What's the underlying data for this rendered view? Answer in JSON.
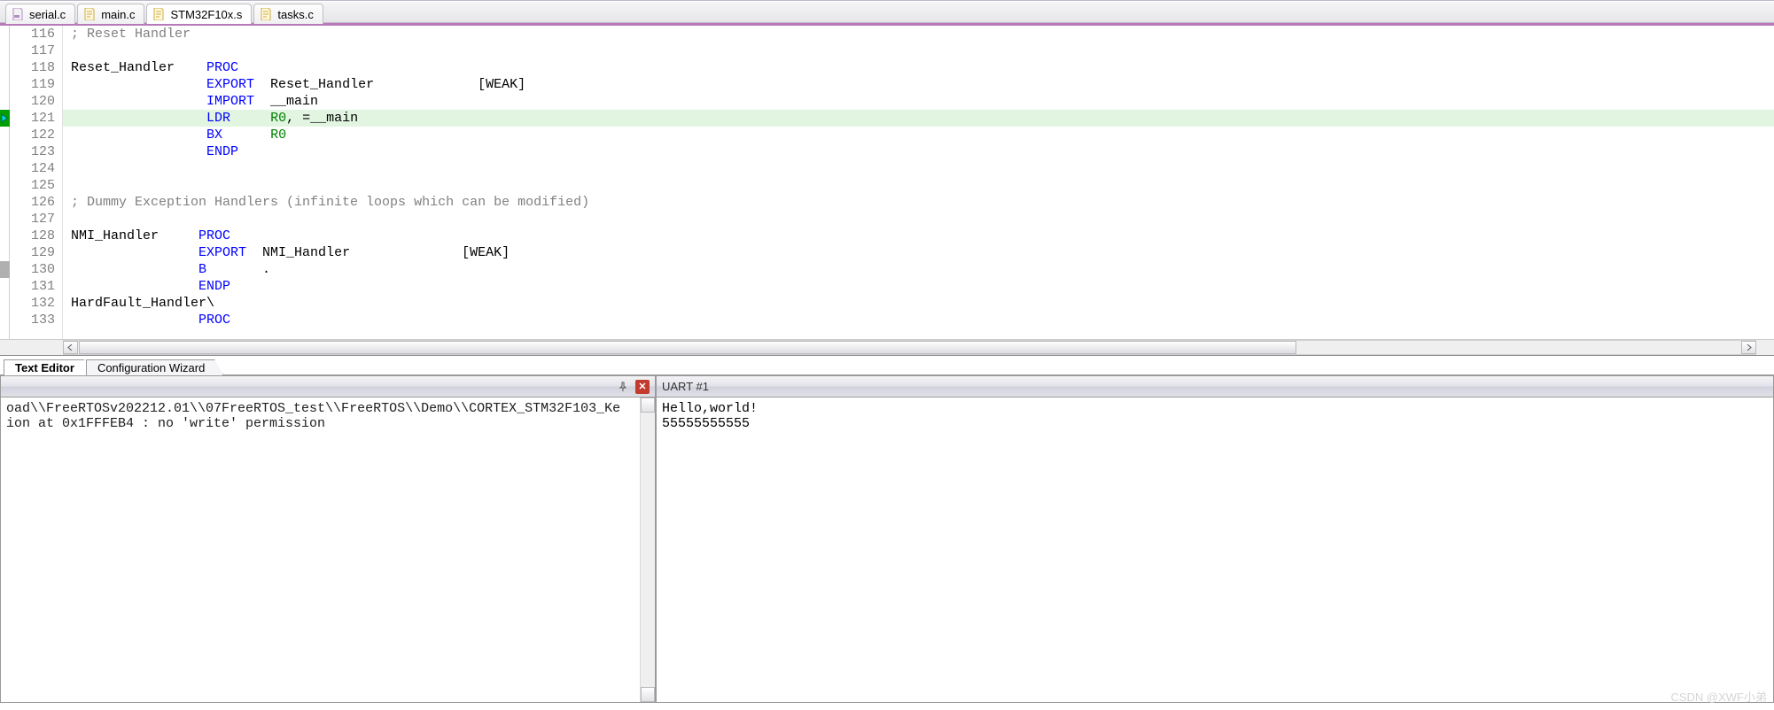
{
  "tabs": {
    "items": [
      {
        "label": "serial.c",
        "icon": "c",
        "active": false
      },
      {
        "label": "main.c",
        "icon": "txt",
        "active": false
      },
      {
        "label": "STM32F10x.s",
        "icon": "txt",
        "active": true
      },
      {
        "label": "tasks.c",
        "icon": "txt",
        "active": false
      }
    ]
  },
  "code": {
    "lines": [
      {
        "n": 116,
        "style": "cmt",
        "t": " ; Reset Handler"
      },
      {
        "n": 117,
        "style": "",
        "t": " "
      },
      {
        "n": 118,
        "style": "",
        "parts": [
          {
            "t": " Reset_Handler    ",
            "c": ""
          },
          {
            "t": "PROC",
            "c": "kw"
          }
        ]
      },
      {
        "n": 119,
        "style": "",
        "parts": [
          {
            "t": "                  ",
            "c": ""
          },
          {
            "t": "EXPORT",
            "c": "kw"
          },
          {
            "t": "  Reset_Handler             [",
            "c": ""
          },
          {
            "t": "WEAK",
            "c": ""
          },
          {
            "t": "]",
            "c": ""
          }
        ]
      },
      {
        "n": 120,
        "style": "",
        "parts": [
          {
            "t": "                  ",
            "c": ""
          },
          {
            "t": "IMPORT",
            "c": "kw"
          },
          {
            "t": "  __main",
            "c": ""
          }
        ]
      },
      {
        "n": 121,
        "style": "hl",
        "exec": true,
        "parts": [
          {
            "t": "                  ",
            "c": ""
          },
          {
            "t": "LDR",
            "c": "kw"
          },
          {
            "t": "     ",
            "c": ""
          },
          {
            "t": "R0",
            "c": "reg"
          },
          {
            "t": ", =__main",
            "c": ""
          }
        ]
      },
      {
        "n": 122,
        "style": "",
        "parts": [
          {
            "t": "                  ",
            "c": ""
          },
          {
            "t": "BX",
            "c": "kw"
          },
          {
            "t": "      ",
            "c": ""
          },
          {
            "t": "R0",
            "c": "reg"
          }
        ]
      },
      {
        "n": 123,
        "style": "",
        "parts": [
          {
            "t": "                  ",
            "c": ""
          },
          {
            "t": "ENDP",
            "c": "kw"
          }
        ]
      },
      {
        "n": 124,
        "style": "",
        "t": " "
      },
      {
        "n": 125,
        "style": "",
        "t": " "
      },
      {
        "n": 126,
        "style": "cmt",
        "t": " ; Dummy Exception Handlers (infinite loops which can be modified)"
      },
      {
        "n": 127,
        "style": "",
        "t": " "
      },
      {
        "n": 128,
        "style": "",
        "parts": [
          {
            "t": " NMI_Handler     ",
            "c": ""
          },
          {
            "t": "PROC",
            "c": "kw"
          }
        ]
      },
      {
        "n": 129,
        "style": "",
        "parts": [
          {
            "t": "                 ",
            "c": ""
          },
          {
            "t": "EXPORT",
            "c": "kw"
          },
          {
            "t": "  NMI_Handler              [",
            "c": ""
          },
          {
            "t": "WEAK",
            "c": ""
          },
          {
            "t": "]",
            "c": ""
          }
        ]
      },
      {
        "n": 130,
        "style": "",
        "bm": true,
        "parts": [
          {
            "t": "                 ",
            "c": ""
          },
          {
            "t": "B",
            "c": "kw"
          },
          {
            "t": "       .",
            "c": ""
          }
        ]
      },
      {
        "n": 131,
        "style": "",
        "parts": [
          {
            "t": "                 ",
            "c": ""
          },
          {
            "t": "ENDP",
            "c": "kw"
          }
        ]
      },
      {
        "n": 132,
        "style": "",
        "parts": [
          {
            "t": " HardFault_Handler\\",
            "c": ""
          }
        ]
      },
      {
        "n": 133,
        "style": "",
        "parts": [
          {
            "t": "                 ",
            "c": ""
          },
          {
            "t": "PROC",
            "c": "kw"
          }
        ]
      }
    ]
  },
  "bottom_tabs": {
    "items": [
      {
        "label": "Text Editor",
        "active": true
      },
      {
        "label": "Configuration Wizard",
        "active": false
      }
    ]
  },
  "output_panel": {
    "line1": "oad\\\\FreeRTOSv202212.01\\\\07FreeRTOS_test\\\\FreeRTOS\\\\Demo\\\\CORTEX_STM32F103_Ke",
    "line2": "ion at 0x1FFFEB4 : no 'write' permission"
  },
  "uart_panel": {
    "title": "UART #1",
    "line1": "Hello,world!",
    "line2": "55555555555"
  },
  "watermark": "CSDN @XWF小弟"
}
